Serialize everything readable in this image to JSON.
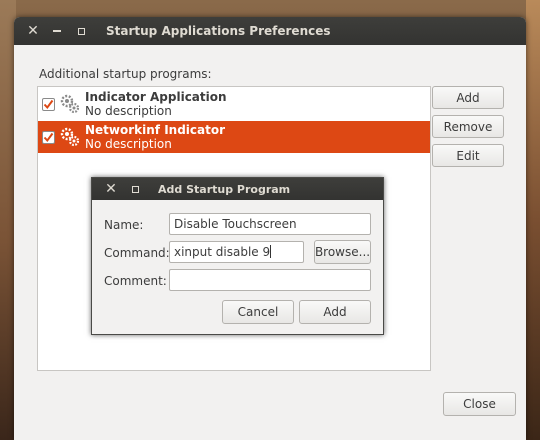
{
  "main_window": {
    "title": "Startup Applications Preferences",
    "section_label": "Additional startup programs:",
    "programs": [
      {
        "name": "Indicator Application",
        "description": "No description",
        "checked": true,
        "selected": false
      },
      {
        "name": "Networkinf Indicator",
        "description": "No description",
        "checked": true,
        "selected": true
      }
    ],
    "buttons": {
      "add": "Add",
      "remove": "Remove",
      "edit": "Edit",
      "close": "Close"
    }
  },
  "dialog": {
    "title": "Add Startup Program",
    "name_label": "Name:",
    "name_value": "Disable Touchscreen",
    "command_label": "Command:",
    "command_value": "xinput disable 9",
    "browse_label": "Browse...",
    "comment_label": "Comment:",
    "comment_value": "",
    "cancel_label": "Cancel",
    "add_label": "Add"
  },
  "colors": {
    "selection": "#dd4814",
    "titlebar": "#3c3b37",
    "window_bg": "#f2f1f0"
  },
  "icons": [
    "close-icon",
    "minimize-icon",
    "maximize-icon",
    "gears-icon",
    "checkmark-icon"
  ]
}
